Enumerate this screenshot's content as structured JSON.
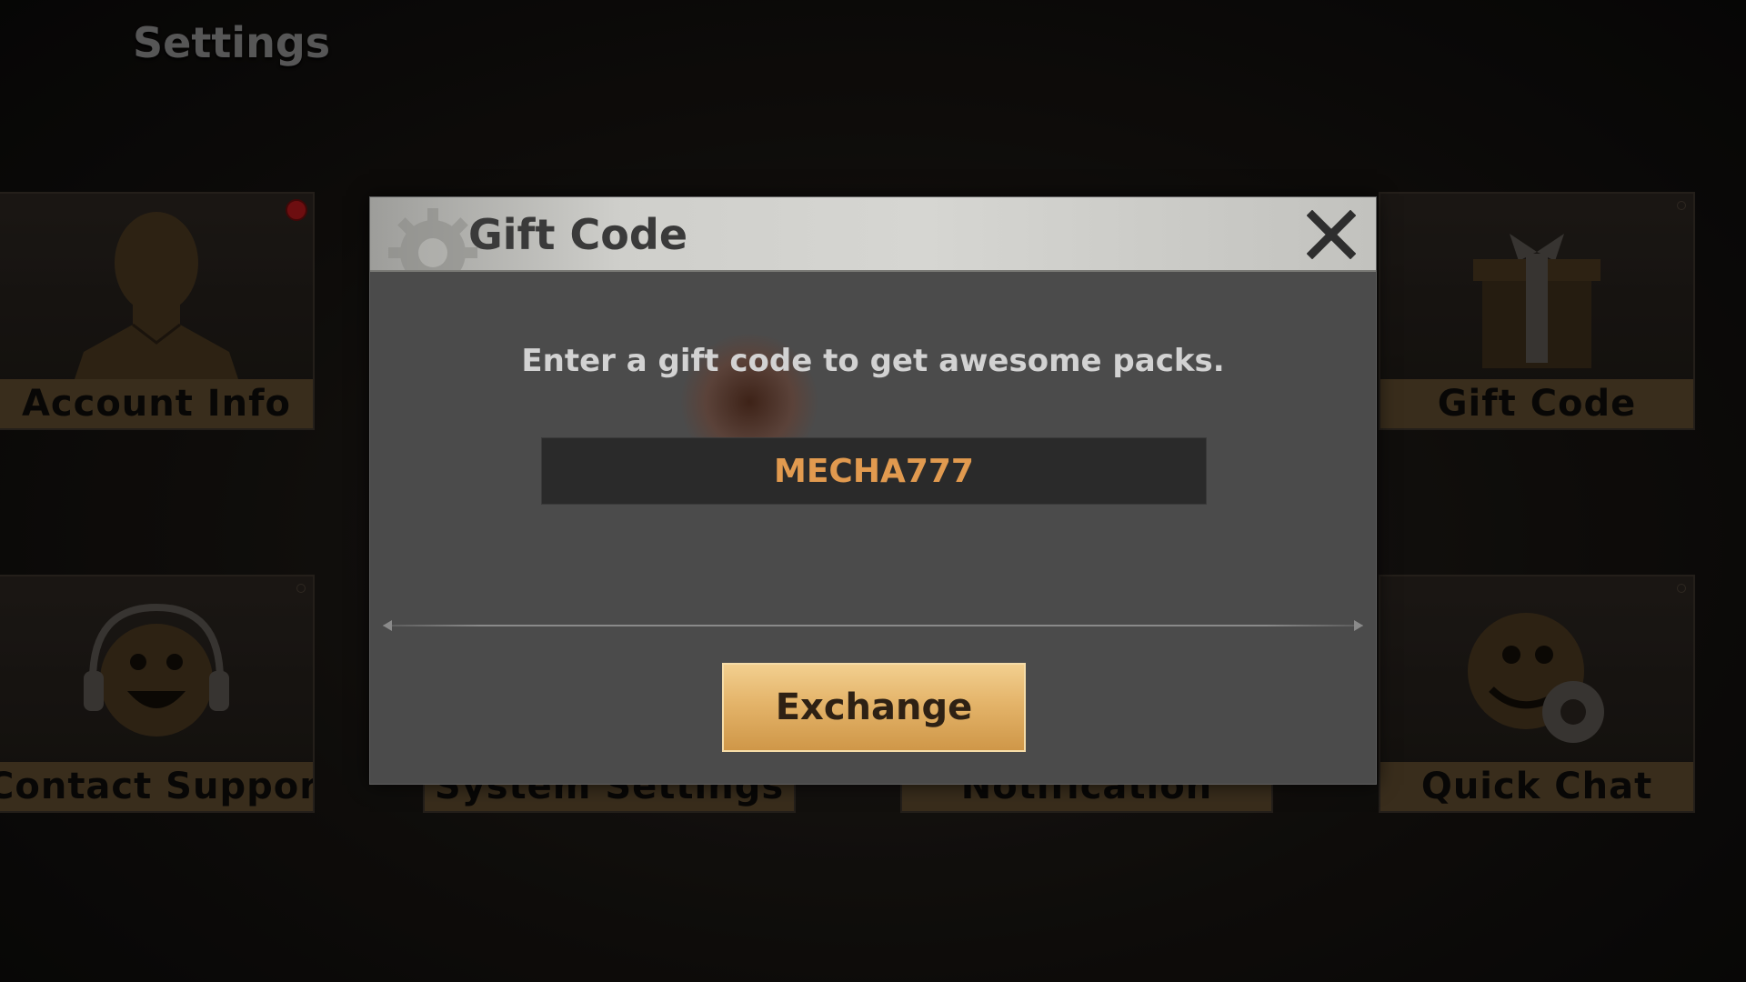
{
  "page": {
    "title": "Settings"
  },
  "tiles": [
    {
      "label": "Account Info",
      "icon": "person-icon",
      "has_alert": true
    },
    {
      "label": "Gift Code",
      "icon": "gift-icon"
    },
    {
      "label": "Contact Support",
      "icon": "headset-smiley-icon"
    },
    {
      "label": "System Settings",
      "icon": "gear-icon"
    },
    {
      "label": "Notification",
      "icon": "bell-icon"
    },
    {
      "label": "Quick Chat",
      "icon": "smiley-gear-icon"
    }
  ],
  "dialog": {
    "title": "Gift Code",
    "description": "Enter a gift code to get awesome packs.",
    "code_value": "MECHA777",
    "exchange_label": "Exchange"
  },
  "colors": {
    "accent_orange": "#e19a4f",
    "button_gold": "#e4b46a",
    "alert_red": "#b0181a"
  }
}
